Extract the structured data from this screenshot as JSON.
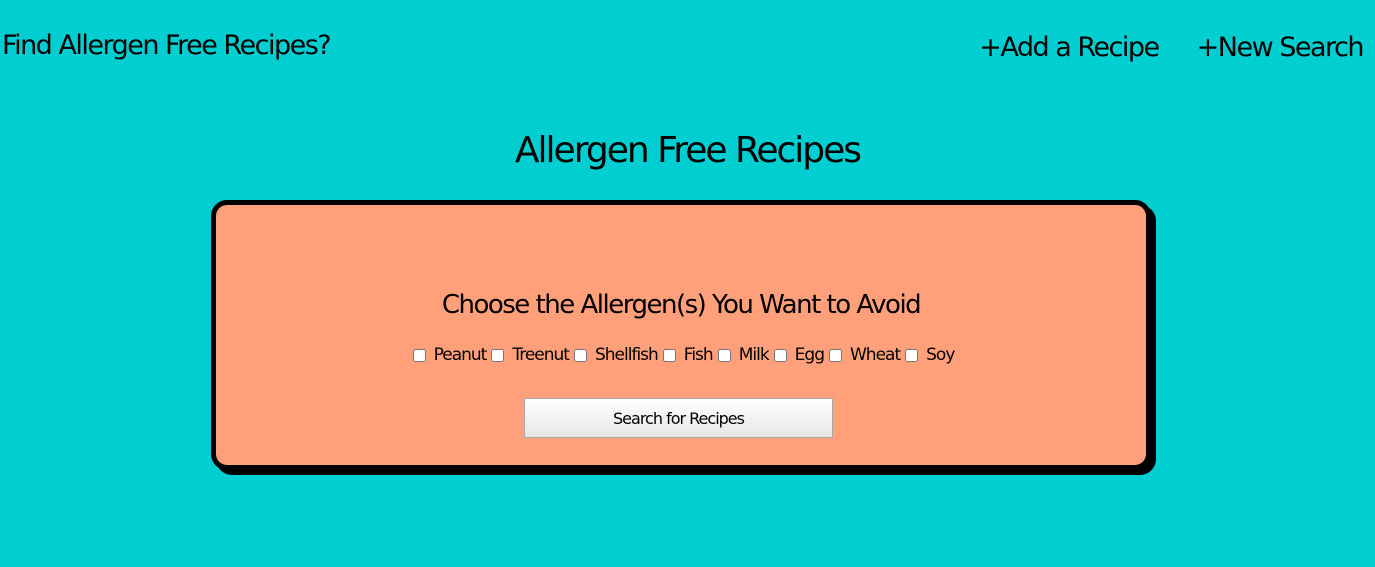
{
  "header": {
    "brand": "Find Allergen Free Recipes?",
    "nav": [
      {
        "label": "+Add a Recipe"
      },
      {
        "label": "+New Search"
      }
    ]
  },
  "main": {
    "title": "Allergen Free Recipes",
    "card": {
      "heading": "Choose the Allergen(s) You Want to Avoid",
      "allergens": [
        {
          "label": "Peanut",
          "checked": false
        },
        {
          "label": "Treenut",
          "checked": false
        },
        {
          "label": "Shellfish",
          "checked": false
        },
        {
          "label": "Fish",
          "checked": false
        },
        {
          "label": "Milk",
          "checked": false
        },
        {
          "label": "Egg",
          "checked": false
        },
        {
          "label": "Wheat",
          "checked": false
        },
        {
          "label": "Soy",
          "checked": false
        }
      ],
      "search_button_label": "Search for Recipes"
    }
  },
  "colors": {
    "page_background": "#00ced1",
    "card_background": "#ffa07a",
    "card_border": "#000000"
  }
}
